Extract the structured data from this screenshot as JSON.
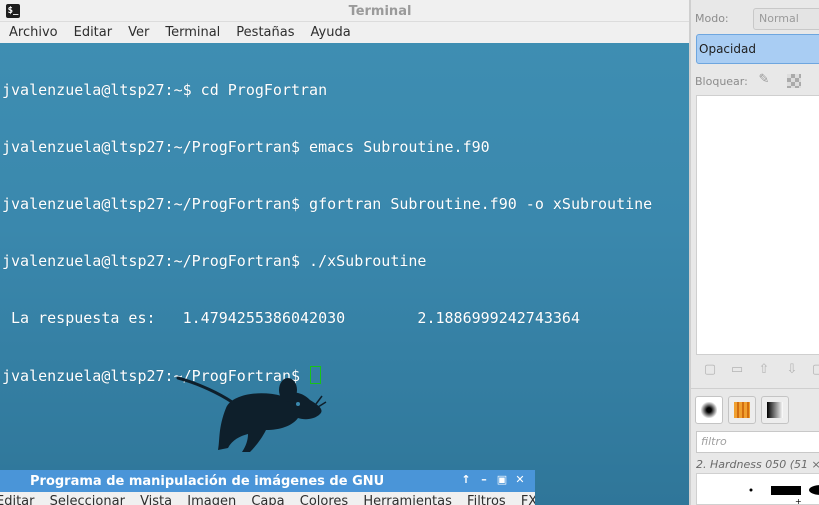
{
  "terminal": {
    "title": "Terminal",
    "icon": "terminal-icon",
    "menu": [
      "Archivo",
      "Editar",
      "Ver",
      "Terminal",
      "Pestañas",
      "Ayuda"
    ],
    "lines": [
      "jvalenzuela@ltsp27:~$ cd ProgFortran",
      "jvalenzuela@ltsp27:~/ProgFortran$ emacs Subroutine.f90",
      "jvalenzuela@ltsp27:~/ProgFortran$ gfortran Subroutine.f90 -o xSubroutine",
      "jvalenzuela@ltsp27:~/ProgFortran$ ./xSubroutine",
      " La respuesta es:   1.4794255386042030        2.1886999242743364",
      "jvalenzuela@ltsp27:~/ProgFortran$ "
    ],
    "cursor_color": "#19c219",
    "text_color": "#ffffff"
  },
  "desktop": {
    "background_color": "#3a88ad",
    "logo": "xfce-mouse-icon"
  },
  "gimp_window": {
    "title": "Programa de manipulación de imágenes de GNU",
    "titlebar_color": "#4a95d8",
    "buttons": [
      "up-arrow-icon",
      "minimize-icon",
      "maximize-icon",
      "close-icon"
    ],
    "menu": [
      "Editar",
      "Seleccionar",
      "Vista",
      "Imagen",
      "Capa",
      "Colores",
      "Herramientas",
      "Filtros",
      "FX"
    ]
  },
  "gimp_dock": {
    "mode_label": "Modo:",
    "mode_value": "Normal",
    "opacity_label": "Opacidad",
    "lock_label": "Bloquear:",
    "filter_placeholder": "filtro",
    "brush_name": "2. Hardness 050 (51 ×"
  }
}
